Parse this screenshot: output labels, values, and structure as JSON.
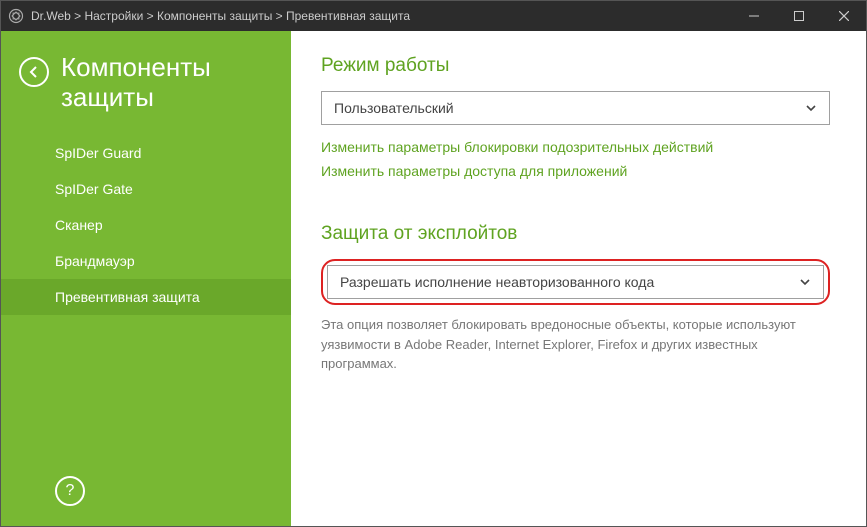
{
  "titlebar": {
    "breadcrumb": "Dr.Web  >  Настройки  >  Компоненты защиты  >  Превентивная защита"
  },
  "sidebar": {
    "title": "Компоненты защиты",
    "items": [
      {
        "label": "SpIDer Guard"
      },
      {
        "label": "SpIDer Gate"
      },
      {
        "label": "Сканер"
      },
      {
        "label": "Брандмауэр"
      },
      {
        "label": "Превентивная защита"
      }
    ],
    "help": "?"
  },
  "content": {
    "mode": {
      "heading": "Режим работы",
      "selected": "Пользовательский",
      "link1": "Изменить параметры блокировки подозрительных действий",
      "link2": "Изменить параметры доступа для приложений"
    },
    "exploit": {
      "heading": "Защита от эксплойтов",
      "selected": "Разрешать исполнение неавторизованного кода",
      "desc": "Эта опция позволяет блокировать вредоносные объекты, которые используют уязвимости в Adobe Reader, Internet Explorer, Firefox и других известных программах."
    }
  }
}
